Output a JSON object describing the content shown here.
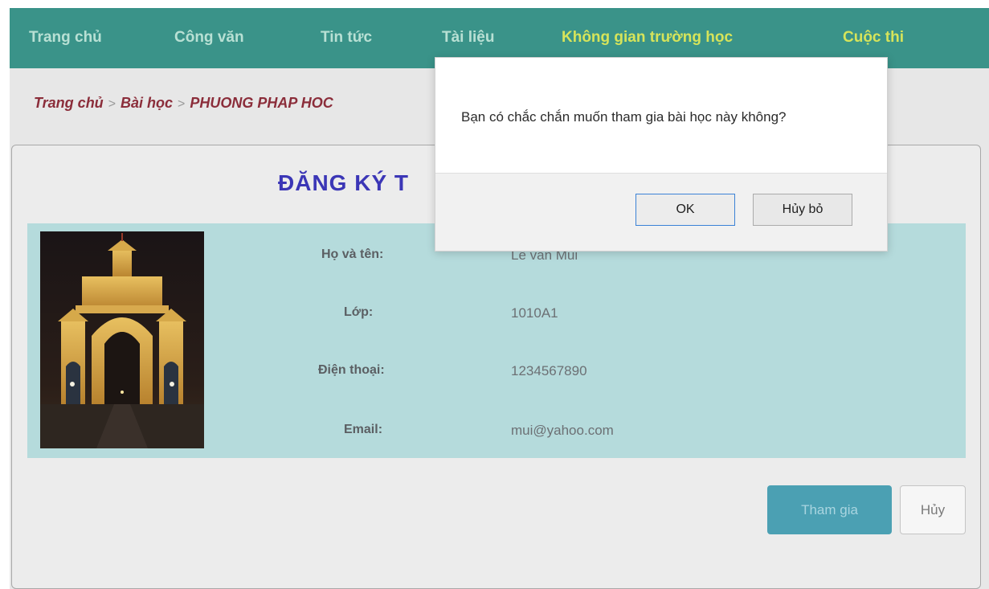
{
  "nav": {
    "items": [
      {
        "label": "Trang chủ",
        "highlight": false
      },
      {
        "label": "Công văn",
        "highlight": false
      },
      {
        "label": "Tin tức",
        "highlight": false
      },
      {
        "label": "Tài liệu",
        "highlight": false
      },
      {
        "label": "Không gian trường học",
        "highlight": true
      },
      {
        "label": "Cuộc thi",
        "highlight": true
      }
    ],
    "background": "#3a9389",
    "text_color": "#b8e0d4",
    "highlight_color": "#d6e45a"
  },
  "breadcrumb": {
    "items": [
      "Trang chủ",
      "Bài học",
      "PHUONG PHAP HOC"
    ],
    "separator": ">"
  },
  "form": {
    "title": "ĐĂNG KÝ T",
    "fields": [
      {
        "label": "Họ và tên:",
        "value": "Lê văn Mùi"
      },
      {
        "label": "Lớp:",
        "value": "1010A1"
      },
      {
        "label": "Điện thoại:",
        "value": "1234567890"
      },
      {
        "label": "Email:",
        "value": "mui@yahoo.com"
      }
    ],
    "join_label": "Tham gia",
    "cancel_label": "Hủy"
  },
  "dialog": {
    "message": "Bạn có chắc chắn muốn tham gia bài học này không?",
    "ok_label": "OK",
    "cancel_label": "Hủy bỏ"
  }
}
